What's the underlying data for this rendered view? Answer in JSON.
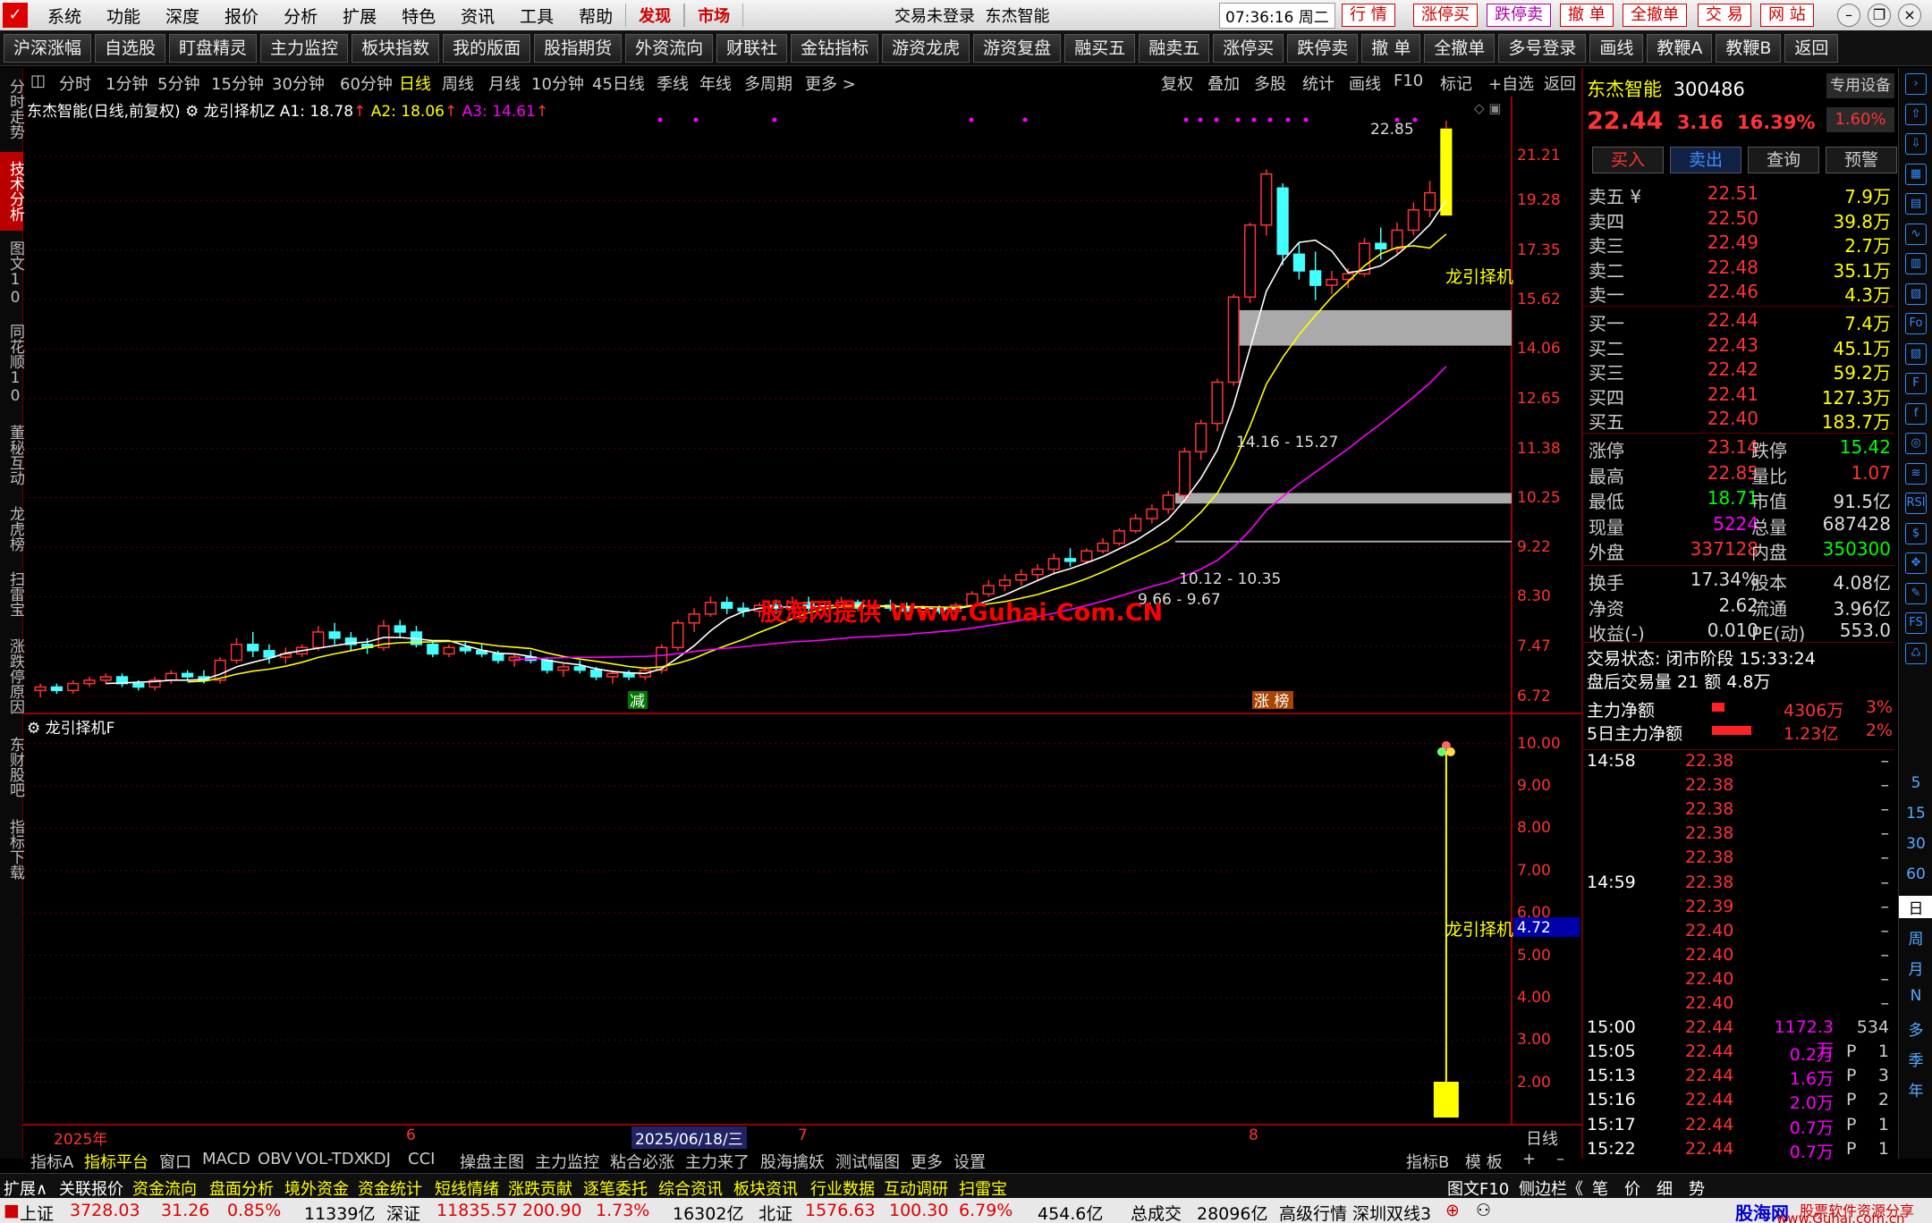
{
  "menu": {
    "items": [
      "系统",
      "功能",
      "深度",
      "报价",
      "分析",
      "扩展",
      "特色",
      "资讯",
      "工具",
      "帮助"
    ],
    "highlight": [
      "发现",
      "市场"
    ],
    "login_status": "交易未登录",
    "stock_title": "东杰智能",
    "time": "07:36:16 周二",
    "right_buttons": [
      "行 情",
      "涨停买",
      "跌停卖",
      "撤 单",
      "全撤单",
      "交 易",
      "网 站"
    ]
  },
  "toolbar": [
    "沪深涨幅",
    "自选股",
    "盯盘精灵",
    "主力监控",
    "板块指数",
    "我的版面",
    "股指期货",
    "外资流向",
    "财联社",
    "金钻指标",
    "游资龙虎",
    "游资复盘",
    "融买五",
    "融卖五",
    "涨停买",
    "跌停卖",
    "撤 单",
    "全撤单",
    "多号登录",
    "画线",
    "教鞭A",
    "教鞭B",
    "返回"
  ],
  "left_tabs": [
    {
      "label": "分时走势",
      "active": false
    },
    {
      "label": "技术分析",
      "active": true
    },
    {
      "label": "图文10",
      "active": false
    },
    {
      "label": "同花顺10",
      "active": false
    },
    {
      "label": "董秘互动",
      "active": false
    },
    {
      "label": "龙虎榜",
      "active": false
    },
    {
      "label": "扫雷宝",
      "active": false
    },
    {
      "label": "涨跌停原因",
      "active": false
    },
    {
      "label": "东财股吧",
      "active": false
    },
    {
      "label": "指标下载",
      "active": false
    }
  ],
  "periods": [
    "分时",
    "1分钟",
    "5分钟",
    "15分钟",
    "30分钟",
    "60分钟",
    "日线",
    "周线",
    "月线",
    "10分钟",
    "45日线",
    "季线",
    "年线",
    "多周期",
    "更多 >"
  ],
  "active_period": "日线",
  "chart_tools": [
    "复权",
    "叠加",
    "多股",
    "统计",
    "画线",
    "F10",
    "标记",
    "+自选",
    "返回"
  ],
  "main_chart": {
    "title": "东杰智能(日线,前复权)",
    "indicator": "龙引择机Z",
    "a1": "A1: 18.78",
    "a2": "A2: 18.06",
    "a3": "A3: 14.61",
    "high_label": "22.85",
    "signal_label": "龙引择机",
    "zone1": "14.16 - 15.27",
    "zone2": "10.12 - 10.35",
    "zone3": "9.66 - 9.67",
    "watermark": "股海网提供 Www.Guhai.Com.CN",
    "markers": [
      "减",
      "涨 榜"
    ],
    "y_ticks": [
      "21.21",
      "19.28",
      "17.35",
      "15.62",
      "14.06",
      "12.65",
      "11.38",
      "10.25",
      "9.22",
      "8.30",
      "7.47",
      "6.72"
    ]
  },
  "sub_chart": {
    "title": "龙引择机F",
    "label": "龙引择机",
    "current": "4.72",
    "y_ticks": [
      "10.00",
      "9.00",
      "8.00",
      "7.00",
      "6.00",
      "5.00",
      "4.00",
      "3.00",
      "2.00"
    ]
  },
  "x_axis": {
    "labels": [
      "2025年",
      "6",
      "2025/06/18/三",
      "7",
      "8"
    ],
    "period": "日线"
  },
  "quote": {
    "name": "东杰智能",
    "code": "300486",
    "price": "22.44",
    "change": "3.16",
    "pct": "16.39%",
    "device_label": "专用设备",
    "device_pct": "1.60%",
    "buttons": [
      "买入",
      "卖出",
      "查询",
      "预警"
    ],
    "asks": [
      {
        "label": "卖五 ¥",
        "price": "22.51",
        "vol": "7.9万"
      },
      {
        "label": "卖四",
        "price": "22.50",
        "vol": "39.8万"
      },
      {
        "label": "卖三",
        "price": "22.49",
        "vol": "2.7万"
      },
      {
        "label": "卖二",
        "price": "22.48",
        "vol": "35.1万"
      },
      {
        "label": "卖一",
        "price": "22.46",
        "vol": "4.3万"
      }
    ],
    "bids": [
      {
        "label": "买一",
        "price": "22.44",
        "vol": "7.4万"
      },
      {
        "label": "买二",
        "price": "22.43",
        "vol": "45.1万"
      },
      {
        "label": "买三",
        "price": "22.42",
        "vol": "59.2万"
      },
      {
        "label": "买四",
        "price": "22.41",
        "vol": "127.3万"
      },
      {
        "label": "买五",
        "price": "22.40",
        "vol": "183.7万"
      }
    ],
    "stats": [
      {
        "k1": "涨停",
        "v1": "23.14",
        "c1": "#f33",
        "k2": "跌停",
        "v2": "15.42",
        "c2": "#0f0"
      },
      {
        "k1": "最高",
        "v1": "22.85",
        "c1": "#f33",
        "k2": "量比",
        "v2": "1.07",
        "c2": "#f33"
      },
      {
        "k1": "最低",
        "v1": "18.71",
        "c1": "#0f0",
        "k2": "市值",
        "v2": "91.5亿",
        "c2": "#ddd"
      },
      {
        "k1": "现量",
        "v1": "5224",
        "c1": "#f0f",
        "k2": "总量",
        "v2": "687428",
        "c2": "#ddd"
      },
      {
        "k1": "外盘",
        "v1": "337128",
        "c1": "#f33",
        "k2": "内盘",
        "v2": "350300",
        "c2": "#0f0"
      }
    ],
    "stats2": [
      {
        "k1": "换手",
        "v1": "17.34%",
        "c1": "#ddd",
        "k2": "股本",
        "v2": "4.08亿",
        "c2": "#ddd"
      },
      {
        "k1": "净资",
        "v1": "2.62",
        "c1": "#ddd",
        "k2": "流通",
        "v2": "3.96亿",
        "c2": "#ddd"
      },
      {
        "k1": "收益(-)",
        "v1": "0.010",
        "c1": "#ddd",
        "k2": "PE(动)",
        "v2": "553.0",
        "c2": "#ddd"
      }
    ],
    "trade_status": "交易状态: 闭市阶段 15:33:24",
    "after_hours": "盘后交易量 21 额 4.8万",
    "main_net": {
      "label": "主力净额",
      "value": "4306万",
      "pct": "3%"
    },
    "main_net5": {
      "label": "5日主力净额",
      "value": "1.23亿",
      "pct": "2%"
    }
  },
  "ticks": [
    {
      "t": "14:58",
      "p": "22.38",
      "v": "",
      "f": "",
      "n": "–"
    },
    {
      "t": "",
      "p": "22.38",
      "v": "",
      "f": "",
      "n": "–"
    },
    {
      "t": "",
      "p": "22.38",
      "v": "",
      "f": "",
      "n": "–"
    },
    {
      "t": "",
      "p": "22.38",
      "v": "",
      "f": "",
      "n": "–"
    },
    {
      "t": "",
      "p": "22.38",
      "v": "",
      "f": "",
      "n": "–"
    },
    {
      "t": "14:59",
      "p": "22.38",
      "v": "",
      "f": "",
      "n": "–"
    },
    {
      "t": "",
      "p": "22.39",
      "v": "",
      "f": "",
      "n": "–"
    },
    {
      "t": "",
      "p": "22.40",
      "v": "",
      "f": "",
      "n": "–"
    },
    {
      "t": "",
      "p": "22.40",
      "v": "",
      "f": "",
      "n": "–"
    },
    {
      "t": "",
      "p": "22.40",
      "v": "",
      "f": "",
      "n": "–"
    },
    {
      "t": "",
      "p": "22.40",
      "v": "",
      "f": "",
      "n": "–"
    },
    {
      "t": "15:00",
      "p": "22.44",
      "v": "1172.3万",
      "f": "",
      "n": "534"
    },
    {
      "t": "15:05",
      "p": "22.44",
      "v": "0.2万",
      "f": "P",
      "n": "1"
    },
    {
      "t": "15:13",
      "p": "22.44",
      "v": "1.6万",
      "f": "P",
      "n": "3"
    },
    {
      "t": "15:16",
      "p": "22.44",
      "v": "2.0万",
      "f": "P",
      "n": "2"
    },
    {
      "t": "15:17",
      "p": "22.44",
      "v": "0.7万",
      "f": "P",
      "n": "1"
    },
    {
      "t": "15:22",
      "p": "22.44",
      "v": "0.7万",
      "f": "P",
      "n": "1"
    }
  ],
  "right_icons": [
    "5",
    "15",
    "30",
    "60",
    "日",
    "周",
    "月",
    "N",
    "多",
    "季",
    "年"
  ],
  "indicator_tabs": [
    "指标A",
    "指标平台",
    "窗口",
    "MACD",
    "OBV",
    "VOL-TDX",
    "KDJ",
    "CCI",
    "操盘主图",
    "主力监控",
    "粘合必涨",
    "主力来了",
    "股海擒妖",
    "测试幅图",
    "更多",
    "设置"
  ],
  "indicator_tabs_right": [
    "指标B",
    "模 板",
    "+",
    "–"
  ],
  "link_bar": [
    "扩展∧",
    "关联报价",
    "资金流向",
    "盘面分析",
    "境外资金",
    "资金统计",
    "短线情绪",
    "涨跌贡献",
    "逐笔委托",
    "综合资讯",
    "板块资讯",
    "行业数据",
    "互动调研",
    "扫雷宝"
  ],
  "link_bar_right": [
    "图文F10",
    "侧边栏《",
    "笔",
    "价",
    "细",
    "势"
  ],
  "status": {
    "sh": {
      "name": "上证",
      "v": "3728.03",
      "c": "31.26",
      "p": "0.85%",
      "amt": "11339亿"
    },
    "sz": {
      "name": "深证",
      "v": "11835.57",
      "c": "200.90",
      "p": "1.73%",
      "amt": "16302亿"
    },
    "bj": {
      "name": "北证",
      "v": "1576.63",
      "c": "100.30",
      "p": "6.79%",
      "amt": "454.6亿"
    },
    "total": "总成交",
    "total_amt": "28096亿",
    "line": "高级行情 深圳双线3"
  },
  "brand": {
    "name": "股海网",
    "slogan": "股票软件资源分享",
    "url": "www.Guhai.com.cn"
  },
  "chart_data": {
    "type": "candlestick",
    "title": "东杰智能(日线,前复权)",
    "ylim": [
      6.5,
      23.5
    ],
    "candles": [
      [
        6.8,
        6.9,
        6.7,
        6.85
      ],
      [
        6.85,
        6.9,
        6.75,
        6.8
      ],
      [
        6.8,
        6.95,
        6.75,
        6.9
      ],
      [
        6.9,
        7.0,
        6.85,
        6.95
      ],
      [
        6.95,
        7.05,
        6.9,
        7.0
      ],
      [
        7.0,
        7.05,
        6.85,
        6.9
      ],
      [
        6.9,
        6.95,
        6.8,
        6.85
      ],
      [
        6.85,
        7.0,
        6.8,
        6.95
      ],
      [
        6.95,
        7.1,
        6.9,
        7.05
      ],
      [
        7.05,
        7.1,
        6.95,
        7.0
      ],
      [
        7.0,
        7.1,
        6.9,
        6.95
      ],
      [
        6.95,
        7.3,
        6.9,
        7.25
      ],
      [
        7.25,
        7.6,
        7.2,
        7.5
      ],
      [
        7.5,
        7.7,
        7.3,
        7.4
      ],
      [
        7.4,
        7.5,
        7.2,
        7.3
      ],
      [
        7.3,
        7.45,
        7.2,
        7.35
      ],
      [
        7.35,
        7.5,
        7.3,
        7.45
      ],
      [
        7.45,
        7.8,
        7.4,
        7.7
      ],
      [
        7.7,
        7.85,
        7.5,
        7.6
      ],
      [
        7.6,
        7.7,
        7.4,
        7.5
      ],
      [
        7.5,
        7.6,
        7.35,
        7.45
      ],
      [
        7.45,
        7.9,
        7.4,
        7.8
      ],
      [
        7.8,
        7.9,
        7.6,
        7.7
      ],
      [
        7.7,
        7.8,
        7.45,
        7.5
      ],
      [
        7.5,
        7.55,
        7.3,
        7.35
      ],
      [
        7.35,
        7.5,
        7.3,
        7.45
      ],
      [
        7.45,
        7.55,
        7.35,
        7.4
      ],
      [
        7.4,
        7.5,
        7.3,
        7.35
      ],
      [
        7.35,
        7.4,
        7.2,
        7.25
      ],
      [
        7.25,
        7.35,
        7.15,
        7.3
      ],
      [
        7.3,
        7.4,
        7.2,
        7.25
      ],
      [
        7.25,
        7.3,
        7.05,
        7.1
      ],
      [
        7.1,
        7.2,
        7.0,
        7.15
      ],
      [
        7.15,
        7.25,
        7.05,
        7.1
      ],
      [
        7.1,
        7.15,
        6.95,
        7.0
      ],
      [
        7.0,
        7.1,
        6.9,
        7.05
      ],
      [
        7.05,
        7.1,
        6.95,
        7.0
      ],
      [
        7.0,
        7.15,
        6.95,
        7.1
      ],
      [
        7.1,
        7.5,
        7.05,
        7.45
      ],
      [
        7.45,
        7.9,
        7.4,
        7.85
      ],
      [
        7.85,
        8.1,
        7.7,
        8.0
      ],
      [
        8.0,
        8.3,
        7.95,
        8.2
      ],
      [
        8.2,
        8.3,
        8.0,
        8.1
      ],
      [
        8.1,
        8.2,
        7.95,
        8.05
      ],
      [
        8.05,
        8.2,
        7.95,
        8.15
      ],
      [
        8.15,
        8.25,
        8.0,
        8.1
      ],
      [
        8.1,
        8.3,
        8.05,
        8.2
      ],
      [
        8.2,
        8.3,
        8.05,
        8.1
      ],
      [
        8.1,
        8.2,
        8.0,
        8.15
      ],
      [
        8.15,
        8.3,
        8.1,
        8.2
      ],
      [
        8.2,
        8.25,
        8.05,
        8.1
      ],
      [
        8.1,
        8.2,
        8.0,
        8.15
      ],
      [
        8.15,
        8.25,
        8.05,
        8.1
      ],
      [
        8.1,
        8.2,
        8.0,
        8.05
      ],
      [
        8.05,
        8.15,
        7.95,
        8.1
      ],
      [
        8.1,
        8.15,
        8.0,
        8.05
      ],
      [
        8.05,
        8.2,
        8.0,
        8.15
      ],
      [
        8.15,
        8.4,
        8.1,
        8.35
      ],
      [
        8.35,
        8.6,
        8.3,
        8.5
      ],
      [
        8.5,
        8.7,
        8.4,
        8.6
      ],
      [
        8.6,
        8.8,
        8.5,
        8.7
      ],
      [
        8.7,
        8.9,
        8.6,
        8.8
      ],
      [
        8.8,
        9.1,
        8.7,
        9.0
      ],
      [
        9.0,
        9.2,
        8.85,
        8.95
      ],
      [
        8.95,
        9.2,
        8.9,
        9.15
      ],
      [
        9.15,
        9.4,
        9.1,
        9.3
      ],
      [
        9.3,
        9.6,
        9.25,
        9.55
      ],
      [
        9.55,
        9.9,
        9.5,
        9.8
      ],
      [
        9.8,
        10.1,
        9.7,
        10.0
      ],
      [
        10.0,
        10.4,
        9.9,
        10.3
      ],
      [
        10.3,
        11.4,
        10.2,
        11.3
      ],
      [
        11.3,
        12.1,
        11.1,
        12.0
      ],
      [
        12.0,
        13.2,
        11.8,
        13.1
      ],
      [
        13.1,
        15.8,
        13.0,
        15.7
      ],
      [
        15.7,
        18.4,
        15.5,
        18.3
      ],
      [
        18.3,
        20.6,
        17.9,
        20.4
      ],
      [
        19.8,
        20.0,
        16.8,
        17.2
      ],
      [
        17.2,
        17.6,
        16.3,
        16.6
      ],
      [
        16.6,
        17.3,
        15.6,
        16.1
      ],
      [
        16.1,
        16.6,
        15.8,
        16.3
      ],
      [
        16.3,
        16.7,
        16.0,
        16.5
      ],
      [
        16.5,
        17.8,
        16.4,
        17.6
      ],
      [
        17.6,
        18.2,
        17.0,
        17.4
      ],
      [
        17.4,
        18.4,
        17.2,
        18.1
      ],
      [
        18.1,
        19.2,
        17.9,
        18.9
      ],
      [
        18.9,
        20.1,
        18.6,
        19.6
      ],
      [
        18.7,
        22.85,
        18.71,
        22.44
      ]
    ],
    "sub_values": [
      4.72
    ],
    "sub_ylim": [
      1.0,
      10.5
    ]
  }
}
